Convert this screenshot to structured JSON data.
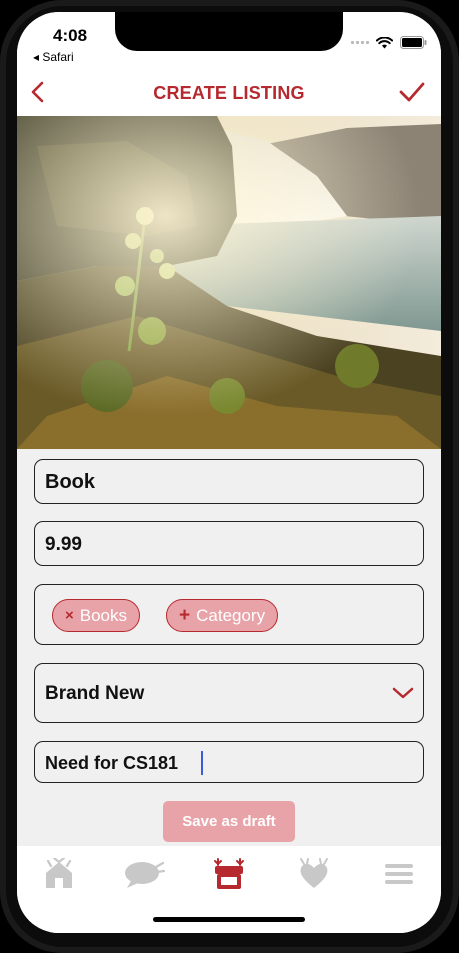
{
  "status": {
    "time": "4:08",
    "back_app": "◂ Safari"
  },
  "nav": {
    "title": "CREATE LISTING",
    "back_icon": "chevron-left-icon",
    "confirm_icon": "checkmark-icon"
  },
  "form": {
    "title_value": "Book",
    "price_value": "9.99",
    "categories": [
      {
        "label": "Books",
        "glyph": "×"
      }
    ],
    "add_category": {
      "label": "Category",
      "glyph": "+"
    },
    "condition_value": "Brand New",
    "description_value": "Need for CS181"
  },
  "actions": {
    "save_draft": "Save as draft"
  },
  "tabs": [
    {
      "icon": "home-icon",
      "active": false
    },
    {
      "icon": "chat-icon",
      "active": false
    },
    {
      "icon": "sell-booth-icon",
      "active": true
    },
    {
      "icon": "favorites-heart-icon",
      "active": false
    },
    {
      "icon": "menu-icon",
      "active": false
    }
  ],
  "colors": {
    "accent": "#b5292f",
    "chip_fill": "#e8a3a8",
    "tab_inactive": "#c8c8c8"
  }
}
